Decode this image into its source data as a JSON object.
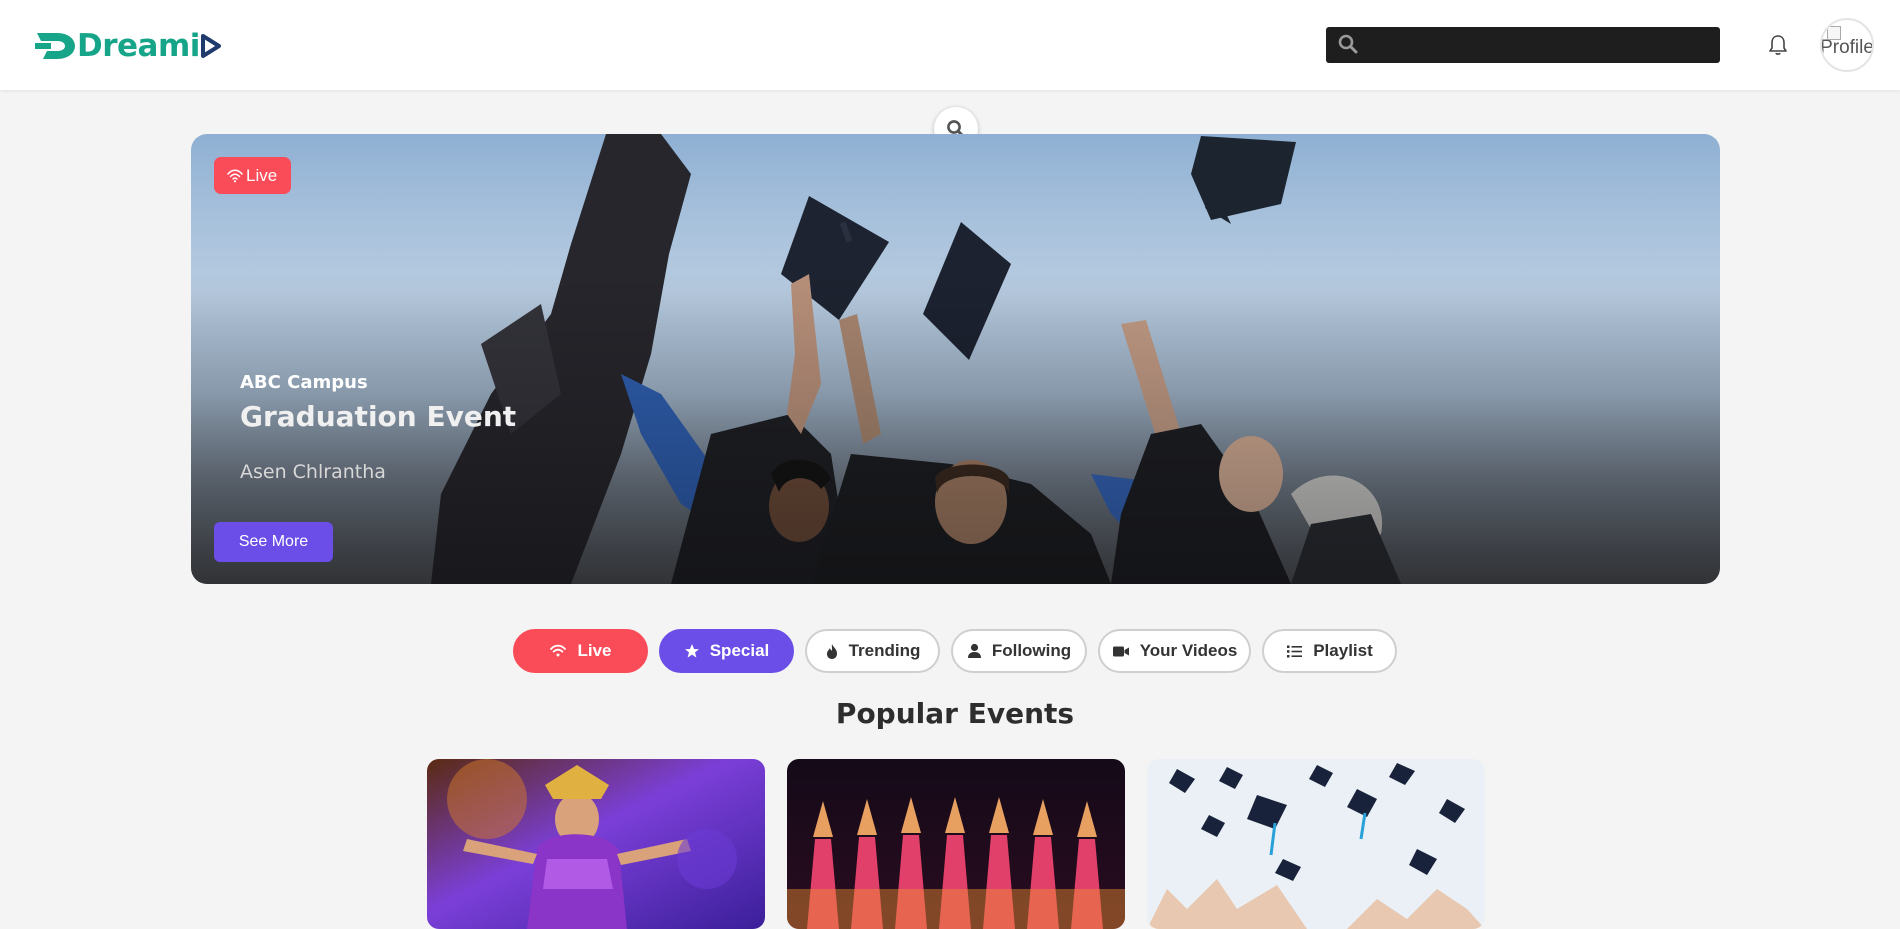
{
  "header": {
    "logo_text": "Dreami",
    "search_placeholder": "",
    "bell_icon": "bell-icon",
    "avatar_alt": "Profile"
  },
  "hero": {
    "badge": "Live",
    "subtitle": "ABC Campus",
    "title": "Graduation Event",
    "author": "Asen Chlrantha",
    "button": "See More"
  },
  "tabs": [
    {
      "label": "Live",
      "icon": "wifi-icon"
    },
    {
      "label": "Special",
      "icon": "star-icon"
    },
    {
      "label": "Trending",
      "icon": "fire-icon"
    },
    {
      "label": "Following",
      "icon": "user-icon"
    },
    {
      "label": "Your Videos",
      "icon": "video-icon"
    },
    {
      "label": "Playlist",
      "icon": "list-icon"
    }
  ],
  "section": {
    "title": "Popular Events"
  },
  "colors": {
    "brand_green": "#17a589",
    "brand_navy": "#1f3b6e",
    "live_red": "#fa4b58",
    "accent_purple": "#6a4ee7"
  }
}
